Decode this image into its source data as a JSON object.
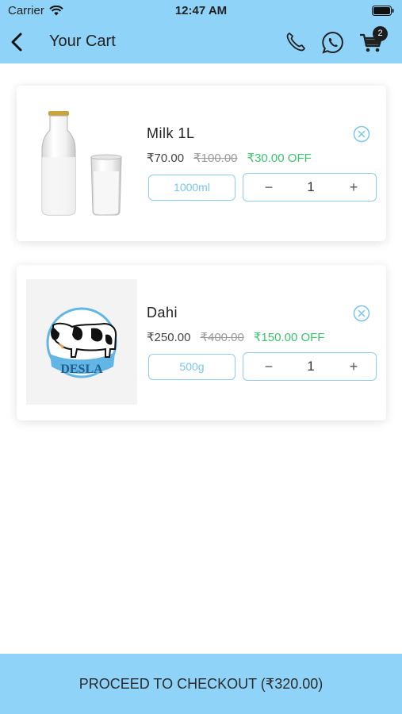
{
  "status_bar": {
    "carrier": "Carrier",
    "time": "12:47 AM"
  },
  "header": {
    "title": "Your Cart",
    "cart_count": "2",
    "accent_color": "#8fd4f8"
  },
  "items": [
    {
      "name": "Milk 1L",
      "price": "₹70.00",
      "old_price": "₹100.00",
      "discount": "₹30.00 OFF",
      "variant": "1000ml",
      "quantity": "1",
      "image": "milk-bottle-and-glass"
    },
    {
      "name": "Dahi",
      "price": "₹250.00",
      "old_price": "₹400.00",
      "discount": "₹150.00 OFF",
      "variant": "500g",
      "quantity": "1",
      "image": "desla-cow-logo",
      "logo_text": "DESLA"
    }
  ],
  "stepper": {
    "minus": "−",
    "plus": "+"
  },
  "footer": {
    "checkout_label": "PROCEED TO CHECKOUT",
    "checkout_total": "(₹320.00)"
  },
  "colors": {
    "discount": "#3cc46d",
    "outline": "#8ccff3"
  }
}
